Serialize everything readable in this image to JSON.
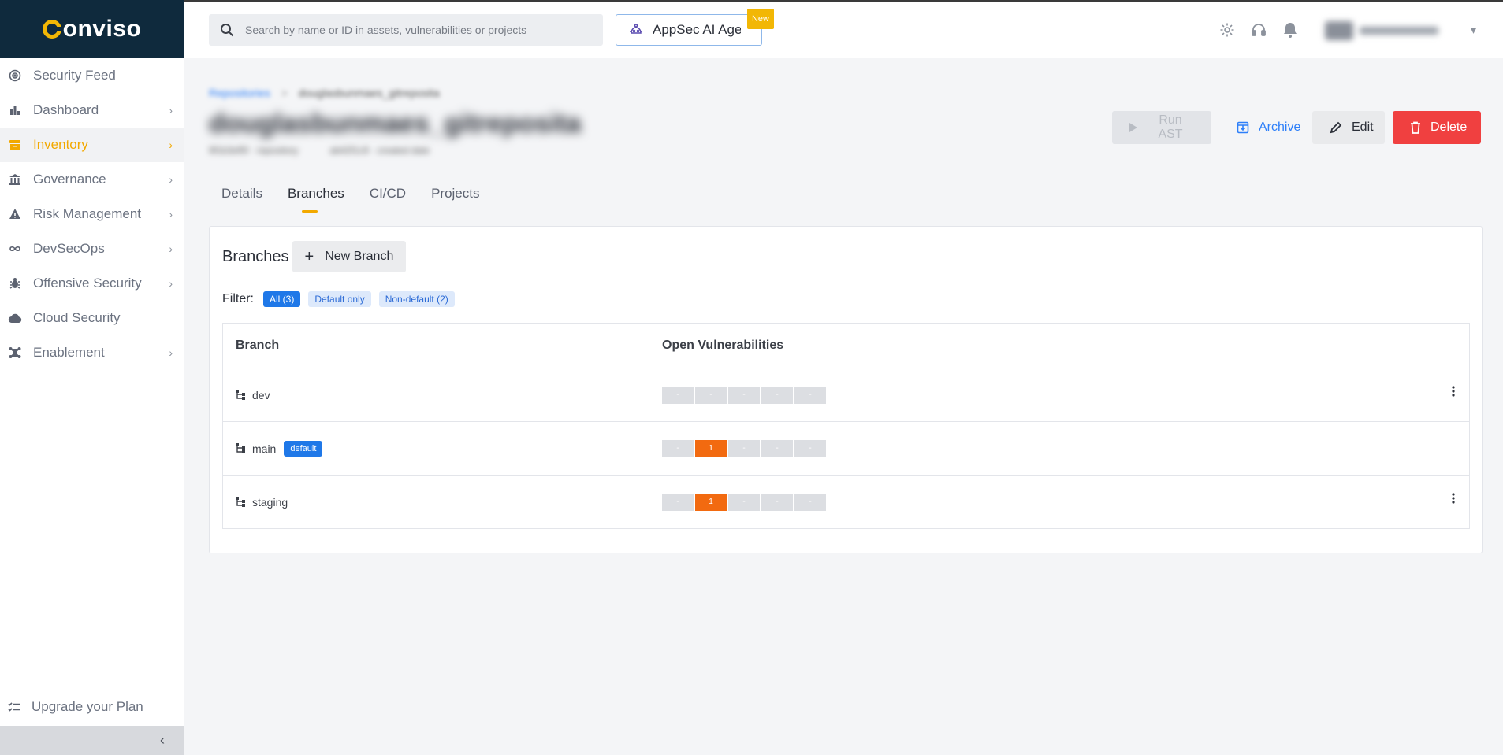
{
  "brand": {
    "logo_text": "onviso"
  },
  "nav": {
    "items": [
      {
        "label": "Security Feed",
        "icon": "radar-icon",
        "chevron": false,
        "active": false
      },
      {
        "label": "Dashboard",
        "icon": "bar-chart-icon",
        "chevron": true,
        "active": false
      },
      {
        "label": "Inventory",
        "icon": "inventory-box-icon",
        "chevron": true,
        "active": true
      },
      {
        "label": "Governance",
        "icon": "bank-icon",
        "chevron": true,
        "active": false
      },
      {
        "label": "Risk Management",
        "icon": "warning-icon",
        "chevron": true,
        "active": false
      },
      {
        "label": "DevSecOps",
        "icon": "infinity-icon",
        "chevron": true,
        "active": false
      },
      {
        "label": "Offensive Security",
        "icon": "bug-icon",
        "chevron": true,
        "active": false
      },
      {
        "label": "Cloud Security",
        "icon": "cloud-icon",
        "chevron": false,
        "active": false
      },
      {
        "label": "Enablement",
        "icon": "network-icon",
        "chevron": true,
        "active": false
      }
    ],
    "upgrade_label": "Upgrade your Plan",
    "collapse_glyph": "‹"
  },
  "topbar": {
    "search_placeholder": "Search by name or ID in assets, vulnerabilities or projects",
    "ai_button_label": "AppSec AI Agent",
    "ai_badge": "New"
  },
  "page": {
    "breadcrumb_link": "Repositories",
    "breadcrumb_current": "douglasbunmaes_gitreposita",
    "title": "douglasbunmaes_gitreposita",
    "meta_1": "9f1b3ef5f · repository",
    "meta_2": "ab42f1c9 · created date",
    "actions": {
      "run_ast": "Run AST",
      "archive": "Archive",
      "edit": "Edit",
      "delete": "Delete"
    },
    "tabs": [
      "Details",
      "Branches",
      "CI/CD",
      "Projects"
    ],
    "active_tab": "Branches"
  },
  "branches": {
    "title": "Branches",
    "new_button": "New Branch",
    "filter_label": "Filter:",
    "filters": [
      "All (3)",
      "Default only",
      "Non-default (2)"
    ],
    "active_filter": "All (3)",
    "columns": [
      "Branch",
      "Open Vulnerabilities"
    ],
    "default_badge": "default",
    "rows": [
      {
        "name": "dev",
        "is_default": false,
        "vulns": [
          "-",
          "-",
          "-",
          "-",
          "-"
        ],
        "menu": true
      },
      {
        "name": "main",
        "is_default": true,
        "vulns": [
          "-",
          "1",
          "-",
          "-",
          "-"
        ],
        "menu": false
      },
      {
        "name": "staging",
        "is_default": false,
        "vulns": [
          "-",
          "1",
          "-",
          "-",
          "-"
        ],
        "menu": true
      }
    ]
  },
  "colors": {
    "brand_dark": "#0f2a3d",
    "accent": "#f2a900",
    "primary": "#1f78e8",
    "danger": "#f04040",
    "vuln_high": "#f26a10"
  }
}
